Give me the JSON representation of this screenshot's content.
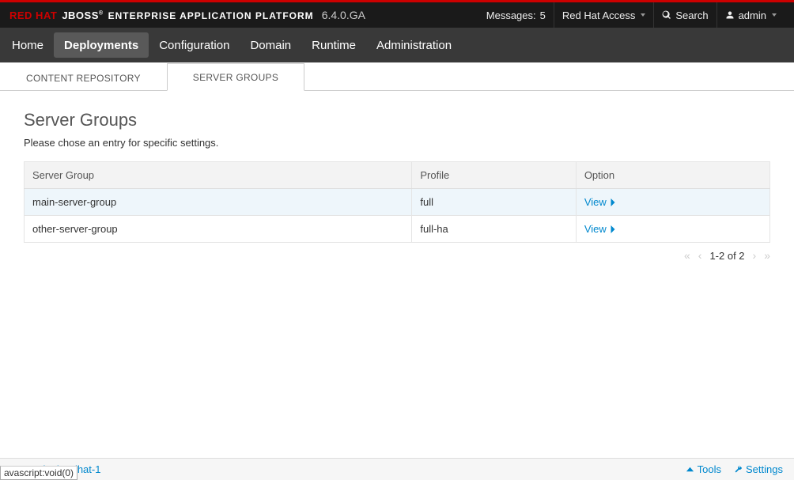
{
  "brand": {
    "red": "RED HAT",
    "jboss": "JBOSS",
    "sub": "ENTERPRISE APPLICATION PLATFORM",
    "version": "6.4.0.GA"
  },
  "topbar": {
    "messages_label": "Messages:",
    "messages_count": "5",
    "access": "Red Hat Access",
    "search": "Search",
    "user": "admin"
  },
  "nav": {
    "items": [
      "Home",
      "Deployments",
      "Configuration",
      "Domain",
      "Runtime",
      "Administration"
    ],
    "active_index": 1
  },
  "subtabs": {
    "items": [
      "CONTENT REPOSITORY",
      "SERVER GROUPS"
    ],
    "active_index": 1
  },
  "page": {
    "title": "Server Groups",
    "description": "Please chose an entry for specific settings."
  },
  "table": {
    "columns": [
      "Server Group",
      "Profile",
      "Option"
    ],
    "view_label": "View",
    "rows": [
      {
        "group": "main-server-group",
        "profile": "full",
        "selected": true
      },
      {
        "group": "other-server-group",
        "profile": "full-ha",
        "selected": false
      }
    ]
  },
  "pager": {
    "text": "1-2 of 2"
  },
  "footer": {
    "version": "2.5.5.Final-redhat-1",
    "tools": "Tools",
    "settings": "Settings"
  },
  "status": "avascript:void(0)"
}
